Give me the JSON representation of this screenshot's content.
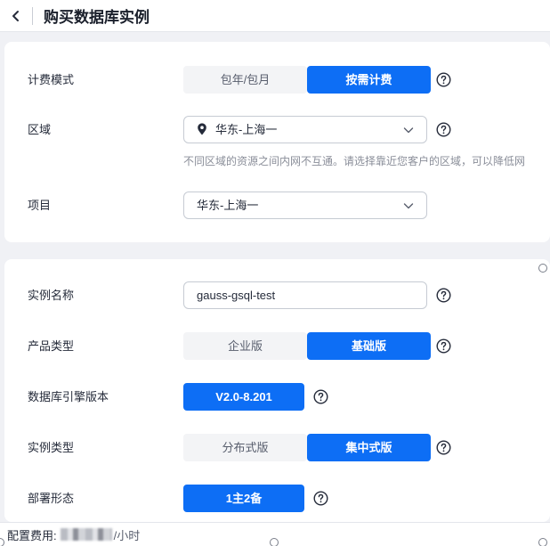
{
  "header": {
    "title": "购买数据库实例"
  },
  "billing": {
    "label": "计费模式",
    "options": [
      "包年/包月",
      "按需计费"
    ],
    "selected": "按需计费"
  },
  "region": {
    "label": "区域",
    "value": "华东-上海一",
    "hint": "不同区域的资源之间内网不互通。请选择靠近您客户的区域，可以降低网"
  },
  "project": {
    "label": "项目",
    "value": "华东-上海一"
  },
  "instance_name": {
    "label": "实例名称",
    "value": "gauss-gsql-test"
  },
  "product_type": {
    "label": "产品类型",
    "options": [
      "企业版",
      "基础版"
    ],
    "selected": "基础版"
  },
  "engine_version": {
    "label": "数据库引擎版本",
    "value": "V2.0-8.201"
  },
  "instance_type": {
    "label": "实例类型",
    "options": [
      "分布式版",
      "集中式版"
    ],
    "selected": "集中式版"
  },
  "deployment": {
    "label": "部署形态",
    "value": "1主2备"
  },
  "footer": {
    "fee_label": "配置费用:",
    "fee_unit": "/小时"
  },
  "colors": {
    "primary": "#0d6ef5",
    "background": "#f0f1f5"
  },
  "icons": {
    "back": "chevron-left-icon",
    "help": "question-circle-icon",
    "location": "location-pin-icon",
    "dropdown": "chevron-down-icon"
  }
}
